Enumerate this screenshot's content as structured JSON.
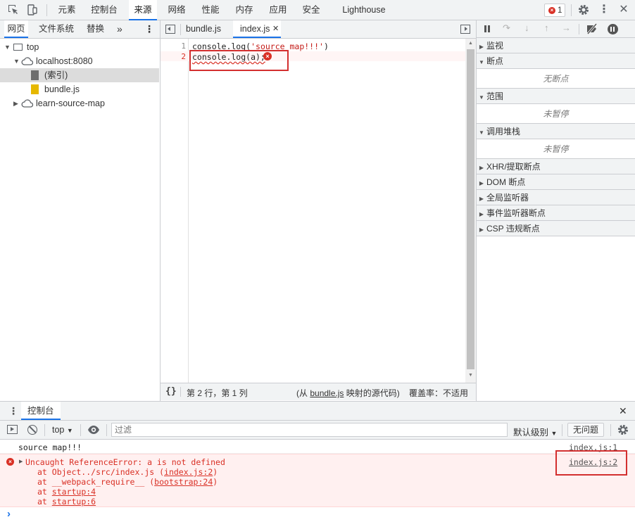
{
  "toolbar": {
    "tabs": [
      "元素",
      "控制台",
      "来源",
      "网络",
      "性能",
      "内存",
      "应用",
      "安全",
      "Lighthouse"
    ],
    "error_count": "1"
  },
  "navigator": {
    "tabs": [
      "网页",
      "文件系统",
      "替换"
    ],
    "tree": {
      "top": "top",
      "host": "localhost:8080",
      "index": "(索引)",
      "bundle": "bundle.js",
      "source_map": "learn-source-map"
    }
  },
  "editor": {
    "tabs": [
      "bundle.js",
      "index.js"
    ],
    "lines": [
      {
        "num": "1",
        "parts": [
          "console.log(",
          "'source map!!!'",
          ")"
        ]
      },
      {
        "num": "2",
        "parts": [
          "console.log(a);"
        ]
      }
    ],
    "status": {
      "position": "第 2 行，第 1 列",
      "mapped_prefix": "(从 ",
      "mapped_file": "bundle.js",
      "mapped_suffix": " 映射的源代码)",
      "coverage": "覆盖率：不适用"
    }
  },
  "debugger": {
    "sections": {
      "watch": "监视",
      "breakpoints": "断点",
      "breakpoints_empty": "无断点",
      "scope": "范围",
      "scope_empty": "未暂停",
      "callstack": "调用堆栈",
      "callstack_empty": "未暂停",
      "xhr": "XHR/提取断点",
      "dom": "DOM 断点",
      "global": "全局监听器",
      "event": "事件监听器断点",
      "csp": "CSP 违规断点"
    }
  },
  "drawer": {
    "title": "控制台",
    "context": "top",
    "filter_placeholder": "过滤",
    "levels": "默认级别",
    "issues": "无问题"
  },
  "console": {
    "log_text": "source map!!!",
    "log_source": "index.js:1",
    "error_title": "Uncaught ReferenceError: a is not defined",
    "error_source": "index.js:2",
    "stack": [
      {
        "prefix": "at Object../src/index.js (",
        "link": "index.js:2",
        "suffix": ")"
      },
      {
        "prefix": "at __webpack_require__ (",
        "link": "bootstrap:24",
        "suffix": ")"
      },
      {
        "prefix": "at ",
        "link": "startup:4",
        "suffix": ""
      },
      {
        "prefix": "at ",
        "link": "startup:6",
        "suffix": ""
      }
    ],
    "prompt": "›"
  },
  "colors": {
    "accent": "#1a73e8",
    "error": "#d93025",
    "error_bg": "#fff0f0",
    "string": "#c41a16",
    "highlight_box": "#d32f2f"
  }
}
